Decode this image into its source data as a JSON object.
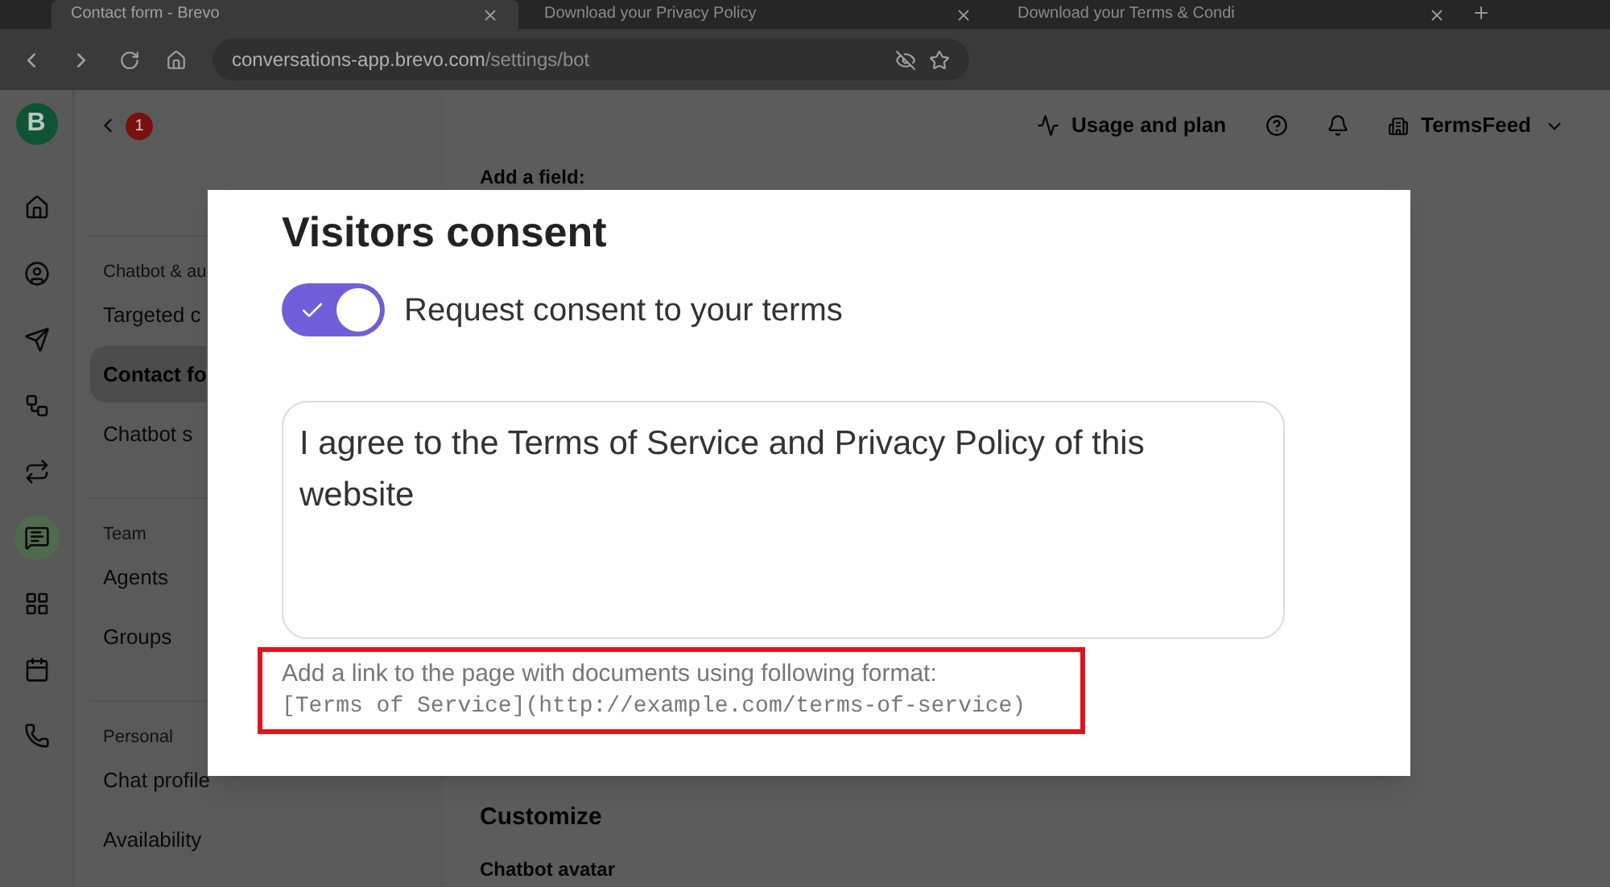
{
  "browser": {
    "tabs": [
      {
        "title": "Contact form - Brevo",
        "selected": true
      },
      {
        "title": "Download your Privacy Policy",
        "selected": false
      },
      {
        "title": "Download your Terms & Condi",
        "selected": false
      }
    ],
    "url": {
      "host": "conversations-app.brevo.com",
      "path": "/settings/bot"
    }
  },
  "app": {
    "logo": "B",
    "rail": [
      {
        "kind": "home",
        "selected": false
      },
      {
        "kind": "contacts",
        "selected": false
      },
      {
        "kind": "send",
        "selected": false
      },
      {
        "kind": "automation",
        "selected": false
      },
      {
        "kind": "sync",
        "selected": false
      },
      {
        "kind": "chat",
        "selected": true
      },
      {
        "kind": "board",
        "selected": false
      },
      {
        "kind": "calendar",
        "selected": false
      },
      {
        "kind": "phone",
        "selected": false
      }
    ],
    "header": {
      "usage": "Usage and plan",
      "account": "TermsFeed"
    },
    "sidebar": {
      "badge": "1",
      "sections": [
        {
          "heading": "Chatbot & au",
          "items": [
            {
              "label": "Targeted c",
              "selected": false
            },
            {
              "label": "Contact fo",
              "selected": true
            },
            {
              "label": "Chatbot s",
              "selected": false
            }
          ]
        },
        {
          "heading": "Team",
          "items": [
            {
              "label": "Agents",
              "selected": false
            },
            {
              "label": "Groups",
              "selected": false
            }
          ]
        },
        {
          "heading": "Personal",
          "items": [
            {
              "label": "Chat profile",
              "selected": false
            },
            {
              "label": "Availability",
              "selected": false
            }
          ]
        }
      ]
    },
    "main": {
      "add_field": "Add a field:",
      "customize": "Customize",
      "avatar_label": "Chatbot avatar"
    }
  },
  "modal": {
    "title": "Visitors consent",
    "toggle": {
      "label": "Request consent to your terms",
      "on": true
    },
    "consent_text": "I agree to the Terms of Service and Privacy Policy of this website",
    "hint": {
      "text": "Add a link to the page with documents using following format:",
      "code": "[Terms of Service](http://example.com/terms-of-service)"
    }
  }
}
